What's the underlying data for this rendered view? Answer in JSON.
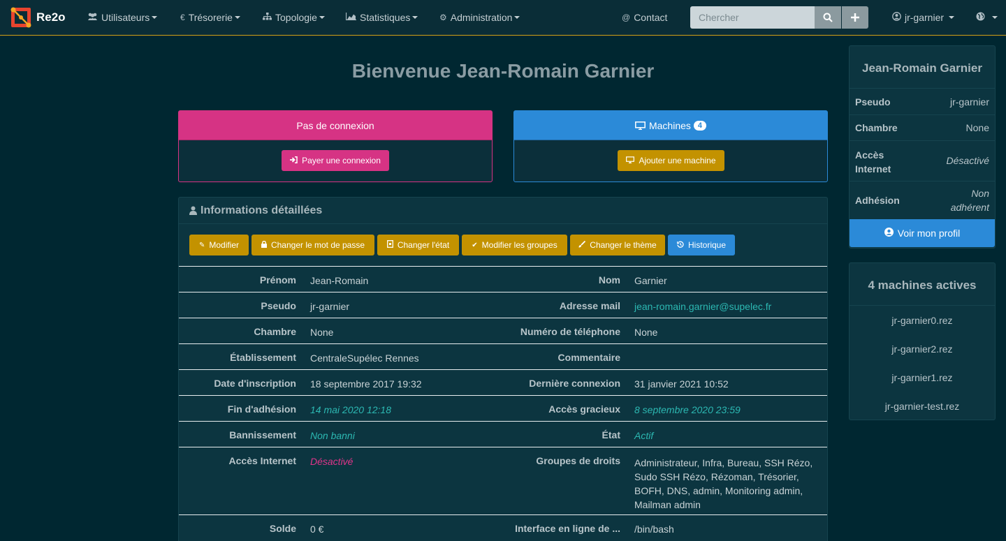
{
  "navbar": {
    "brand": "Re2o",
    "items": [
      {
        "label": "Utilisateurs",
        "icon": "users-icon"
      },
      {
        "label": "Trésorerie",
        "icon": "euro-icon"
      },
      {
        "label": "Topologie",
        "icon": "sitemap-icon"
      },
      {
        "label": "Statistiques",
        "icon": "chart-icon"
      },
      {
        "label": "Administration",
        "icon": "cogs-icon"
      }
    ],
    "contact": "Contact",
    "search_placeholder": "Chercher",
    "user": "jr-garnier"
  },
  "page_title": "Bienvenue Jean-Romain Garnier",
  "connection_card": {
    "title": "Pas de connexion",
    "button": "Payer une connexion",
    "color": "#d63384"
  },
  "machines_card": {
    "title": "Machines",
    "count": "4",
    "button": "Ajouter une machine",
    "color": "#2b8ad8"
  },
  "info": {
    "title": "Informations détaillées",
    "buttons": [
      "Modifier",
      "Changer le mot de passe",
      "Changer l'état",
      "Modifier les groupes",
      "Changer le thème",
      "Historique"
    ],
    "rows": [
      {
        "l1": "Prénom",
        "v1": "Jean-Romain",
        "l2": "Nom",
        "v2": "Garnier"
      },
      {
        "l1": "Pseudo",
        "v1": "jr-garnier",
        "l2": "Adresse mail",
        "v2": "jean-romain.garnier@supelec.fr"
      },
      {
        "l1": "Chambre",
        "v1": "None",
        "l2": "Numéro de téléphone",
        "v2": "None"
      },
      {
        "l1": "Établissement",
        "v1": "CentraleSupélec Rennes",
        "l2": "Commentaire",
        "v2": ""
      },
      {
        "l1": "Date d'inscription",
        "v1": "18 septembre 2017 19:32",
        "l2": "Dernière connexion",
        "v2": "31 janvier 2021 10:52"
      },
      {
        "l1": "Fin d'adhésion",
        "v1": "14 mai 2020 12:18",
        "l2": "Accès gracieux",
        "v2": "8 septembre 2020 23:59"
      },
      {
        "l1": "Bannissement",
        "v1": "Non banni",
        "l2": "État",
        "v2": "Actif"
      },
      {
        "l1": "Accès Internet",
        "v1": "Désactivé",
        "l2": "Groupes de droits",
        "v2": "Administrateur, Infra, Bureau, SSH Rézo, Sudo SSH Rézo, Rézoman, Trésorier, BOFH, DNS, admin, Monitoring admin, Mailman admin"
      },
      {
        "l1": "Solde",
        "v1": "0 €",
        "l2": "Interface en ligne de ...",
        "v2": "/bin/bash"
      }
    ]
  },
  "profile": {
    "name": "Jean-Romain Garnier",
    "rows": [
      {
        "label": "Pseudo",
        "value": "jr-garnier"
      },
      {
        "label": "Chambre",
        "value": "None"
      },
      {
        "label": "Accès Internet",
        "value": "Désactivé"
      },
      {
        "label": "Adhésion",
        "value": "Non adhérent"
      }
    ],
    "button": "Voir mon profil"
  },
  "machines_panel": {
    "title": "4 machines actives",
    "items": [
      "jr-garnier0.rez",
      "jr-garnier2.rez",
      "jr-garnier1.rez",
      "jr-garnier-test.rez"
    ]
  }
}
